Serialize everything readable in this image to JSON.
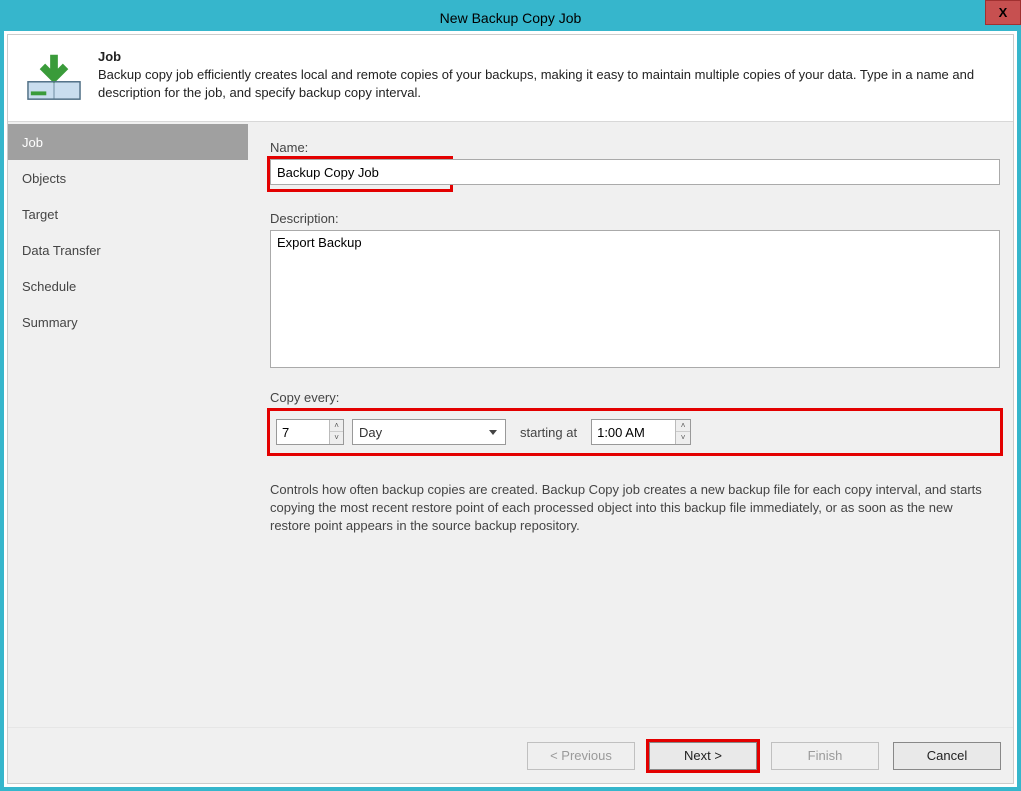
{
  "window": {
    "title": "New Backup Copy Job",
    "close_glyph": "X"
  },
  "header": {
    "title": "Job",
    "description": "Backup copy job efficiently creates local and remote copies of your backups, making it easy to maintain multiple copies of your data. Type in a name and description for the job, and specify backup copy interval."
  },
  "sidebar": {
    "items": [
      {
        "label": "Job",
        "active": true
      },
      {
        "label": "Objects",
        "active": false
      },
      {
        "label": "Target",
        "active": false
      },
      {
        "label": "Data Transfer",
        "active": false
      },
      {
        "label": "Schedule",
        "active": false
      },
      {
        "label": "Summary",
        "active": false
      }
    ]
  },
  "form": {
    "name_label": "Name:",
    "name_value": "Backup Copy Job",
    "description_label": "Description:",
    "description_value": "Export Backup",
    "copy_every_label": "Copy every:",
    "copy_interval_value": "7",
    "copy_unit_value": "Day",
    "starting_at_label": "starting at",
    "starting_at_value": "1:00 AM",
    "help_text": "Controls how often backup copies are created. Backup Copy job creates a new backup file for each copy interval, and starts copying the most recent restore point of each processed object into this backup file immediately, or as soon as the new restore point appears in the source backup repository."
  },
  "footer": {
    "previous_label": "< Previous",
    "next_label": "Next >",
    "finish_label": "Finish",
    "cancel_label": "Cancel"
  },
  "icons": {
    "up_glyph": "˄",
    "down_glyph": "˅"
  }
}
